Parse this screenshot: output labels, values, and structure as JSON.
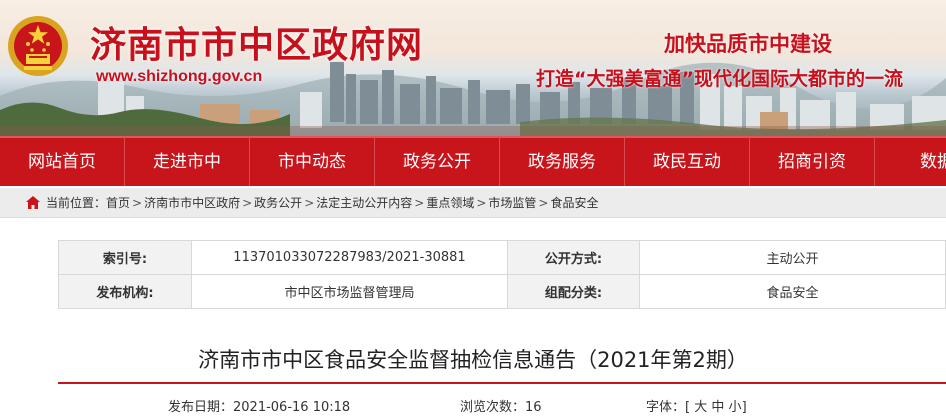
{
  "header": {
    "site_title": "济南市市中区政府网",
    "site_url": "www.shizhong.gov.cn",
    "slogan1": "加快品质市中建设",
    "slogan2": "打造“大强美富通”现代化国际大都市的一流",
    "colors": {
      "brand_red": "#c8141b"
    }
  },
  "nav": {
    "items": [
      "网站首页",
      "走进市中",
      "市中动态",
      "政务公开",
      "政务服务",
      "政民互动",
      "招商引资",
      "数据"
    ]
  },
  "breadcrumb": {
    "prefix": "当前位置：",
    "items": [
      "首页",
      "济南市市中区政府",
      "政务公开",
      "法定主动公开内容",
      "重点领域",
      "市场监管",
      "食品安全"
    ],
    "separator": ">",
    "icon": "home-icon"
  },
  "meta": {
    "index_label": "索引号:",
    "index_value": "113701033072287983/2021-30881",
    "open_label": "公开方式:",
    "open_value": "主动公开",
    "org_label": "发布机构:",
    "org_value": "市中区市场监督管理局",
    "category_label": "组配分类:",
    "category_value": "食品安全"
  },
  "article": {
    "title": "济南市市中区食品安全监督抽检信息通告（2021年第2期）",
    "date_label": "发布日期：",
    "date_value": "2021-06-16 10:18",
    "views_label": "浏览次数：",
    "views_value": "16",
    "font_label": "字体：",
    "font_open": "[",
    "font_large": "大",
    "font_medium": "中",
    "font_small": "小",
    "font_close": "]"
  }
}
